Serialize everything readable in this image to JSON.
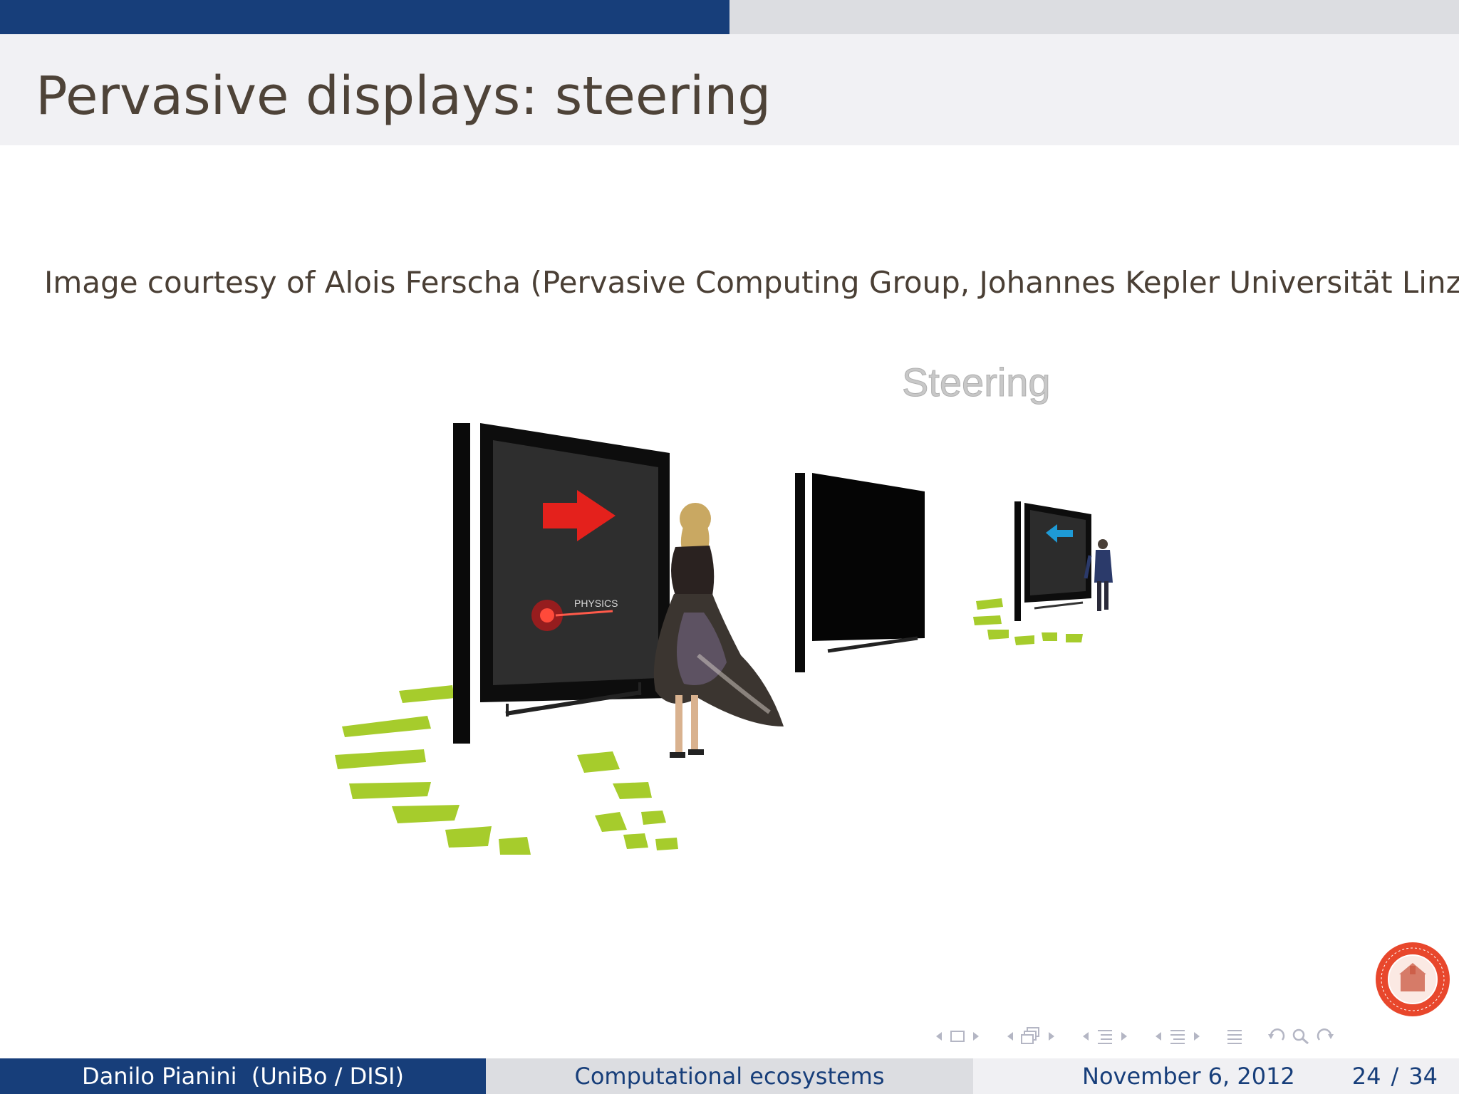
{
  "slide": {
    "title": "Pervasive displays: steering",
    "caption": "Image courtesy of Alois Ferscha (Pervasive Computing Group, Johannes Kepler Universität Linz)"
  },
  "figure": {
    "label": "Steering",
    "screen_text": "PHYSICS"
  },
  "footer": {
    "author": "Danilo Pianini  (UniBo / DISI)",
    "talk_title": "Computational ecosystems",
    "date": "November 6, 2012",
    "page_current": "24",
    "page_sep": "/",
    "page_total": "34"
  },
  "colors": {
    "primary": "#173e7a",
    "title_band": "#f1f1f4",
    "progress_track": "#dcdde1",
    "seal": "#e8472c",
    "floor_marks": "#a6cc2c",
    "arrow_red": "#e4211c",
    "arrow_blue": "#1e9ad6"
  },
  "progress": 0.5,
  "nav_icons": [
    "nav-prev-frame-icon",
    "nav-frame-icon",
    "nav-next-frame-icon",
    "nav-prev-slide-icon",
    "nav-slide-icon",
    "nav-next-slide-icon",
    "nav-prev-section-icon",
    "nav-section-icon",
    "nav-next-section-icon",
    "nav-prev-subsection-icon",
    "nav-subsection-icon",
    "nav-next-subsection-icon",
    "nav-toc-icon",
    "nav-undo-icon",
    "nav-search-icon",
    "nav-redo-icon"
  ]
}
